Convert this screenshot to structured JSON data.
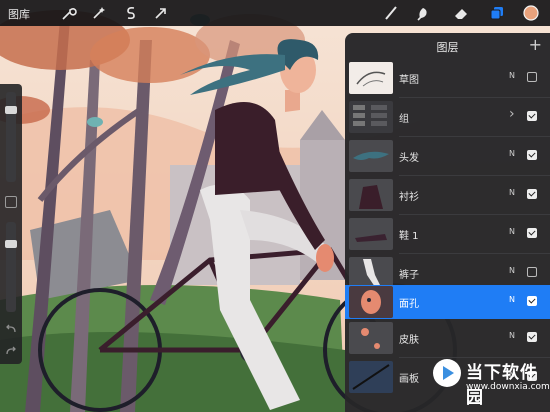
{
  "topbar": {
    "gallery_label": "图库",
    "tools_left": [
      "wrench-icon",
      "magic-wand-icon",
      "selection-s-icon",
      "transform-arrow-icon"
    ],
    "tools_right": [
      "brush-icon",
      "smudge-icon",
      "eraser-icon",
      "layers-icon",
      "color-circle-icon"
    ],
    "active_color": "#e9a27c",
    "accent": "#1f7df5"
  },
  "layers_panel": {
    "title": "图层",
    "add_icon": "+",
    "layers": [
      {
        "name": "草图",
        "mode": "N",
        "visible": false,
        "selected": false,
        "type": "layer"
      },
      {
        "name": "组",
        "mode": "",
        "visible": true,
        "selected": false,
        "type": "group"
      },
      {
        "name": "头发",
        "mode": "N",
        "visible": true,
        "selected": false,
        "type": "layer"
      },
      {
        "name": "衬衫",
        "mode": "N",
        "visible": true,
        "selected": false,
        "type": "layer"
      },
      {
        "name": "鞋 1",
        "mode": "N",
        "visible": true,
        "selected": false,
        "type": "layer"
      },
      {
        "name": "裤子",
        "mode": "N",
        "visible": false,
        "selected": false,
        "type": "layer"
      },
      {
        "name": "面孔",
        "mode": "N",
        "visible": true,
        "selected": true,
        "type": "layer"
      },
      {
        "name": "皮肤",
        "mode": "N",
        "visible": true,
        "selected": false,
        "type": "layer"
      },
      {
        "name": "画板",
        "mode": "N",
        "visible": true,
        "selected": false,
        "type": "layer"
      }
    ]
  },
  "watermark": {
    "title": "当下软件园",
    "url": "www.downxia.com"
  }
}
